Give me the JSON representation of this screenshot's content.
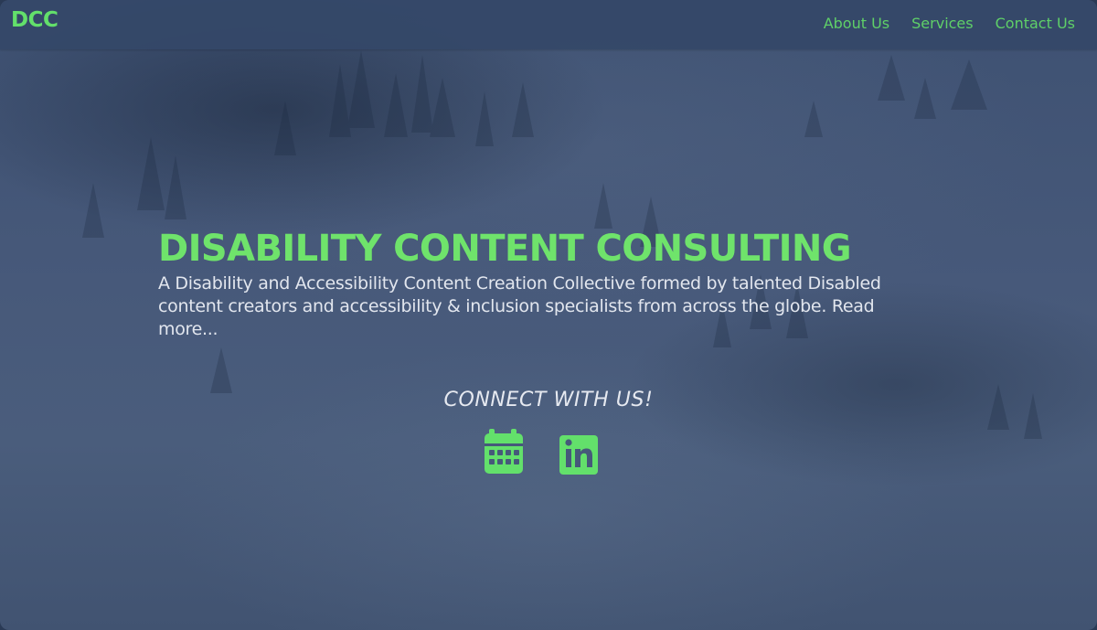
{
  "navbar": {
    "logo": "DCC",
    "links": [
      {
        "label": "About Us"
      },
      {
        "label": "Services"
      },
      {
        "label": "Contact Us"
      }
    ]
  },
  "hero": {
    "title": "DISABILITY CONTENT CONSULTING",
    "description": "A Disability and Accessibility Content Creation Collective formed by talented Disabled content creators and accessibility & inclusion specialists from across the globe.",
    "read_more": "Read more..."
  },
  "connect": {
    "heading": "CONNECT WITH US!",
    "icons": [
      {
        "icon": "calendar-icon"
      },
      {
        "icon": "linkedin-icon"
      }
    ]
  },
  "colors": {
    "accent": "#63e06b",
    "navbar": "#344868",
    "background": "#46597a",
    "text": "#e2e6ee"
  }
}
